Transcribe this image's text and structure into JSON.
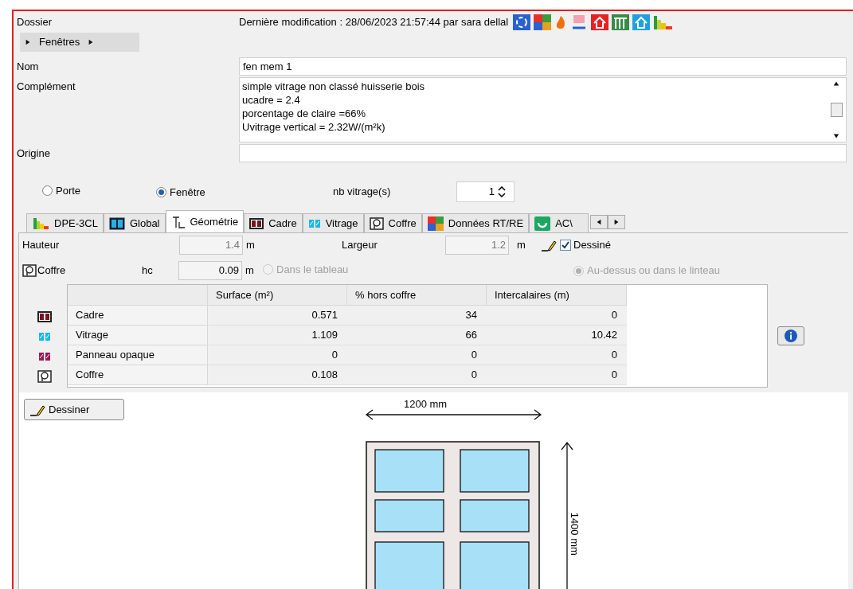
{
  "header": {
    "label": "Dossier",
    "modification": "Dernière modification : 28/06/2023 21:57:44 par sara dellal"
  },
  "breadcrumb": {
    "label": "Fenêtres"
  },
  "fields": [
    {
      "label": "Nom",
      "value": "fen mem 1"
    },
    {
      "label": "Complément",
      "value": "simple vitrage non classé huisserie bois\nucadre = 2.4\nporcentage de claire =66%\nUvitrage vertical = 2.32W/(m²k)"
    },
    {
      "label": "Origine"
    }
  ],
  "type_options": [
    {
      "label": "Porte",
      "selected": false,
      "disabled": false
    },
    {
      "label": "Fenêtre",
      "selected": true,
      "disabled": false
    }
  ],
  "nb_vitrage": {
    "label": "nb vitrage(s)",
    "value": "1"
  },
  "tabs": [
    {
      "label": "DPE-3CL",
      "selected": false
    },
    {
      "label": "Global",
      "selected": false
    },
    {
      "label": "Géométrie",
      "selected": true
    },
    {
      "label": "Cadre",
      "selected": false
    },
    {
      "label": "Vitrage",
      "selected": false
    },
    {
      "label": "Coffre",
      "selected": false
    },
    {
      "label": "Données RT/RE",
      "selected": false
    },
    {
      "label": "AC\\",
      "selected": false
    }
  ],
  "geometry": {
    "hauteur": {
      "label": "Hauteur",
      "value": "1.4",
      "unit": "m",
      "disabled": true
    },
    "largeur": {
      "label": "Largeur",
      "value": "1.2",
      "unit": "m",
      "disabled": true
    },
    "dessine": {
      "label": "Dessiné",
      "checked": true
    },
    "coffre": {
      "label": "Coffre",
      "hc_label": "hc",
      "value": "0.09",
      "unit": "m"
    },
    "coffre_options": [
      {
        "label": "Dans le tableau",
        "selected": false,
        "disabled": true
      },
      {
        "label": "Au-dessus ou dans le linteau",
        "selected": true,
        "disabled": true
      }
    ]
  },
  "table": {
    "columns": [
      "Surface (m²)",
      "% hors coffre",
      "Intercalaires (m)"
    ],
    "rows": [
      {
        "name": "Cadre",
        "cells": [
          "0.571",
          "34",
          "0"
        ]
      },
      {
        "name": "Vitrage",
        "cells": [
          "1.109",
          "66",
          "10.42"
        ]
      },
      {
        "name": "Panneau opaque",
        "cells": [
          "0",
          "0",
          "0"
        ]
      },
      {
        "name": "Coffre",
        "cells": [
          "0.108",
          "0",
          "0"
        ]
      }
    ]
  },
  "draw_button": {
    "label": "Dessiner"
  },
  "drawing": {
    "width_label": "1200 mm",
    "height_label": "1400 mm"
  }
}
